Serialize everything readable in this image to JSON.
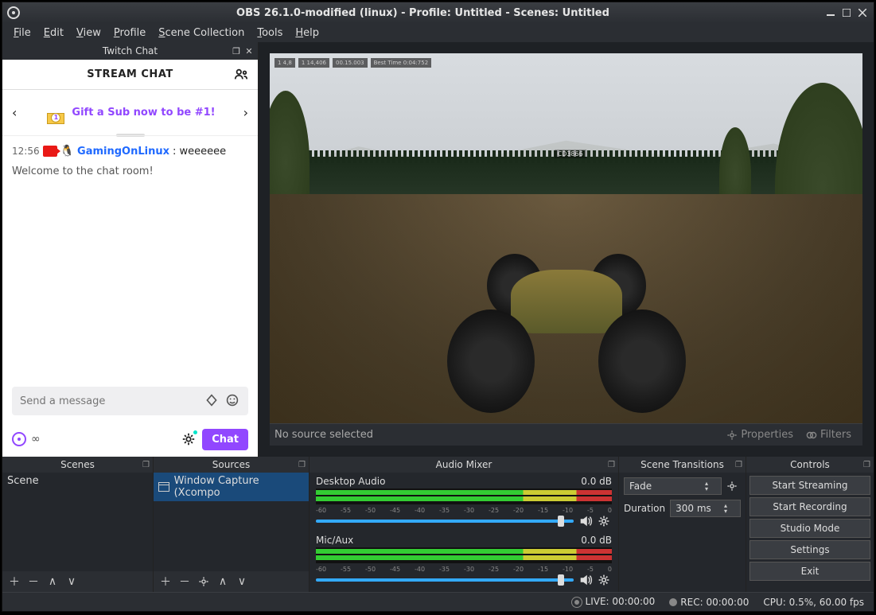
{
  "title": "OBS 26.1.0-modified (linux) - Profile: Untitled - Scenes: Untitled",
  "menubar": [
    "File",
    "Edit",
    "View",
    "Profile",
    "Scene Collection",
    "Tools",
    "Help"
  ],
  "twitch": {
    "dock_title": "Twitch Chat",
    "chat_title": "STREAM CHAT",
    "gift_text": "Gift a Sub now to be #1!",
    "gift_badge": "1",
    "msg_ts": "12:56",
    "msg_user": "GamingOnLinux",
    "msg_text": ": weeeeee",
    "welcome": "Welcome to the chat room!",
    "input_placeholder": "Send a message",
    "chat_btn": "Chat",
    "points": "∞"
  },
  "source_toolbar": {
    "label": "No source selected",
    "properties": "Properties",
    "filters": "Filters"
  },
  "hud": [
    "1  4,8",
    "1  14,406",
    "00.15.003",
    "Best Time  0:04:752"
  ],
  "nametag": "CD3866",
  "panels": {
    "scenes": "Scenes",
    "sources": "Sources",
    "mixer": "Audio Mixer",
    "transitions": "Scene Transitions",
    "controls": "Controls"
  },
  "scenes_list": [
    "Scene"
  ],
  "sources_list": [
    "Window Capture (Xcompo"
  ],
  "mixer_channels": [
    {
      "name": "Desktop Audio",
      "db": "0.0 dB"
    },
    {
      "name": "Mic/Aux",
      "db": "0.0 dB"
    }
  ],
  "meter_ticks": [
    "-60",
    "-55",
    "-50",
    "-45",
    "-40",
    "-35",
    "-30",
    "-25",
    "-20",
    "-15",
    "-10",
    "-5",
    "0"
  ],
  "transitions": {
    "type": "Fade",
    "duration_label": "Duration",
    "duration_value": "300 ms"
  },
  "controls": [
    "Start Streaming",
    "Start Recording",
    "Studio Mode",
    "Settings",
    "Exit"
  ],
  "status": {
    "live": "LIVE: 00:00:00",
    "rec": "REC: 00:00:00",
    "cpu": "CPU: 0.5%, 60.00 fps"
  }
}
